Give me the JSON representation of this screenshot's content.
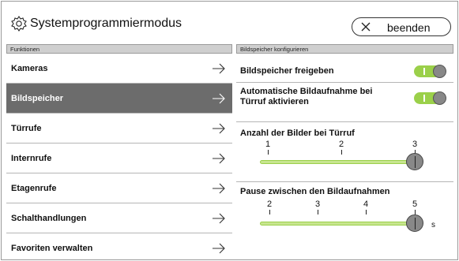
{
  "header": {
    "title": "Systemprogrammiermodus",
    "exit_label": "beenden"
  },
  "left": {
    "section_label": "Funktionen",
    "items": [
      {
        "label": "Kameras",
        "active": false
      },
      {
        "label": "Bildspeicher",
        "active": true
      },
      {
        "label": "Türrufe",
        "active": false
      },
      {
        "label": "Internrufe",
        "active": false
      },
      {
        "label": "Etagenrufe",
        "active": false
      },
      {
        "label": "Schalthandlungen",
        "active": false
      },
      {
        "label": "Favoriten verwalten",
        "active": false
      }
    ]
  },
  "right": {
    "section_label": "Bildspeicher konfigurieren",
    "toggle1": {
      "label": "Bildspeicher freigeben",
      "on": true
    },
    "toggle2": {
      "label_line1": "Automatische Bildaufnahme bei",
      "label_line2": "Türruf aktivieren",
      "on": true
    },
    "slider1": {
      "label": "Anzahl der Bilder bei Türruf",
      "ticks": [
        "1",
        "2",
        "3"
      ],
      "min": 1,
      "max": 3,
      "value": 3
    },
    "slider2": {
      "label": "Pause zwischen den Bildaufnahmen",
      "ticks": [
        "2",
        "3",
        "4",
        "5"
      ],
      "min": 2,
      "max": 5,
      "value": 5,
      "unit": "s"
    }
  },
  "colors": {
    "accent": "#9bd04a",
    "active_row": "#6c6c6c"
  }
}
